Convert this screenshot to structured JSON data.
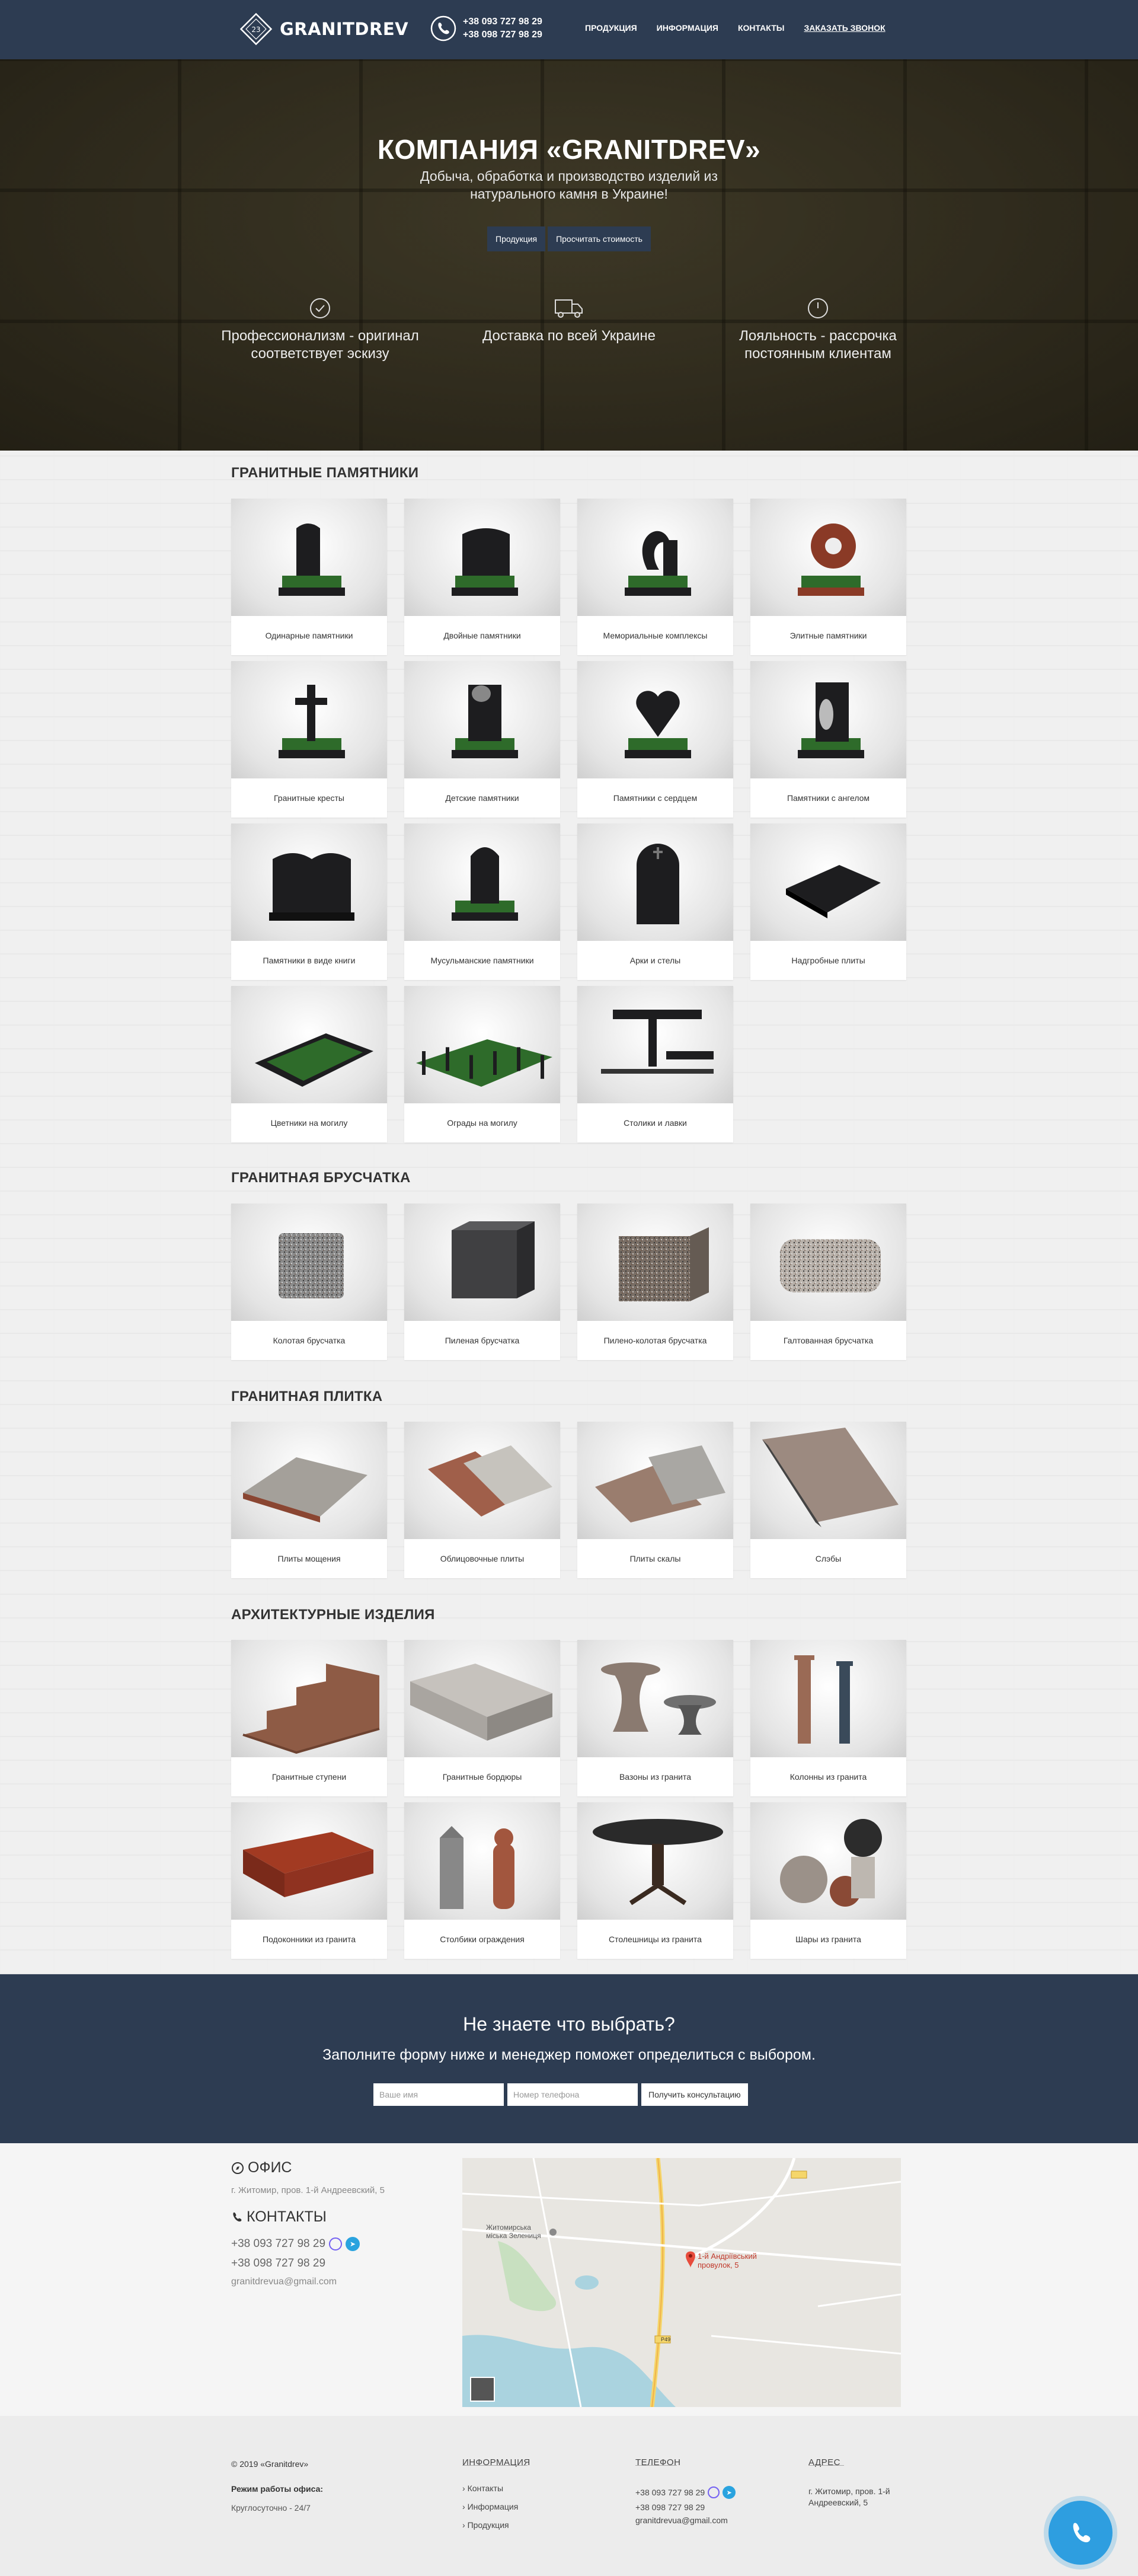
{
  "header": {
    "logo_text": "GRANITDREV",
    "phone1": "+38 093 727 98 29",
    "phone2": "+38 098 727 98 29",
    "nav": [
      "ПРОДУКЦИЯ",
      "ИНФОРМАЦИЯ",
      "КОНТАКТЫ",
      "ЗАКАЗАТЬ ЗВОНОК"
    ]
  },
  "hero": {
    "title": "КОМПАНИЯ «GRANITDREV»",
    "subtitle": "Добыча, обработка и производство изделий из натурального камня в Украине!",
    "btn_products": "Продукция",
    "btn_calc": "Просчитать стоимость",
    "features": [
      {
        "icon": "check-circle-icon",
        "text": "Профессионализм - оригинал соответствует эскизу"
      },
      {
        "icon": "truck-icon",
        "text": "Доставка по всей Украине"
      },
      {
        "icon": "clock-icon",
        "text": "Лояльность - рассрочка постоянным клиентам"
      }
    ]
  },
  "sections": [
    {
      "title": "ГРАНИТНЫЕ ПАМЯТНИКИ",
      "items": [
        "Одинарные памятники",
        "Двойные памятники",
        "Мемориальные комплексы",
        "Элитные памятники",
        "Гранитные кресты",
        "Детские памятники",
        "Памятники с сердцем",
        "Памятники с ангелом",
        "Памятники в виде книги",
        "Мусульманские памятники",
        "Арки и стелы",
        "Надгробные плиты",
        "Цветники на могилу",
        "Ограды на могилу",
        "Столики и лавки"
      ]
    },
    {
      "title": "ГРАНИТНАЯ БРУСЧАТКА",
      "items": [
        "Колотая брусчатка",
        "Пиленая брусчатка",
        "Пилено-колотая брусчатка",
        "Галтованная брусчатка"
      ]
    },
    {
      "title": "ГРАНИТНАЯ ПЛИТКА",
      "items": [
        "Плиты мощения",
        "Облицовочные плиты",
        "Плиты скалы",
        "Слэбы"
      ]
    },
    {
      "title": "АРХИТЕКТУРНЫЕ ИЗДЕЛИЯ",
      "items": [
        "Гранитные ступени",
        "Гранитные бордюры",
        "Вазоны из гранита",
        "Колонны из гранита",
        "Подоконники из гранита",
        "Столбики ограждения",
        "Столешницы из гранита",
        "Шары из гранита"
      ]
    }
  ],
  "help": {
    "title": "Не знаете что выбрать?",
    "subtitle": "Заполните форму ниже и менеджер поможет определиться с выбором.",
    "name_placeholder": "Ваше имя",
    "phone_placeholder": "Номер телефона",
    "submit": "Получить консультацию"
  },
  "contacts": {
    "office_title": "ОФИС",
    "address": "г. Житомир, пров. 1-й Андреевский, 5",
    "contacts_title": "КОНТАКТЫ",
    "phone1": "+38 093 727 98 29",
    "phone2": "+38 098 727 98 29",
    "email": "granitdrevua@gmail.com",
    "map_label1": "Житомирська міська Зелениця",
    "map_label2": "1-й Андріївський провулок, 5",
    "map_road": "Р49"
  },
  "footer": {
    "copyright": "© 2019 «Granitdrev»",
    "hours_title": "Режим работы офиса:",
    "hours": "Круглосуточно - 24/7",
    "info_title": "ИНФОРМАЦИЯ",
    "info_links": [
      "Контакты",
      "Информация",
      "Продукция"
    ],
    "phone_title": "ТЕЛЕФОН",
    "phone1": "+38 093 727 98 29",
    "phone2": "+38 098 727 98 29",
    "email": "granitdrevua@gmail.com",
    "address_title": "АДРЕС",
    "address": "г. Житомир, пров. 1-й Андреевский, 5"
  },
  "colors": {
    "navy": "#2d3c52",
    "chat_blue": "#2e9ee0",
    "viber": "#7360f2",
    "telegram": "#2aa3df"
  }
}
